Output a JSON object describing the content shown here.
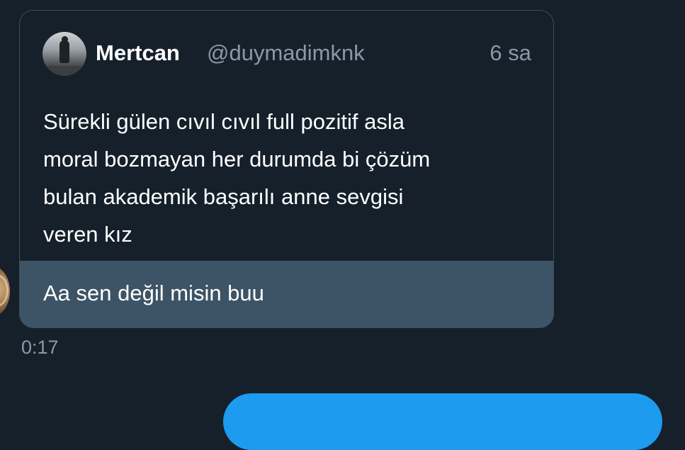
{
  "received_message": {
    "quoted_tweet": {
      "author_name": "Mertcan",
      "author_handle": "@duymadimknk",
      "time_ago": "6 sa",
      "text_lines": [
        "Sürekli gülen cıvıl cıvıl full pozitif asla",
        "moral bozmayan her durumda bi çözüm",
        "bulan akademik başarılı anne sevgisi",
        "veren kız"
      ]
    },
    "reply_text": "Aa sen değil misin buu",
    "timestamp": "0:17"
  },
  "colors": {
    "background": "#15202b",
    "reply_background": "#3d5466",
    "secondary_text": "#8b98a5",
    "sent_bubble": "#1d9bf0"
  },
  "icons": {
    "author_avatar": "avatar",
    "sender_avatar": "avatar"
  }
}
